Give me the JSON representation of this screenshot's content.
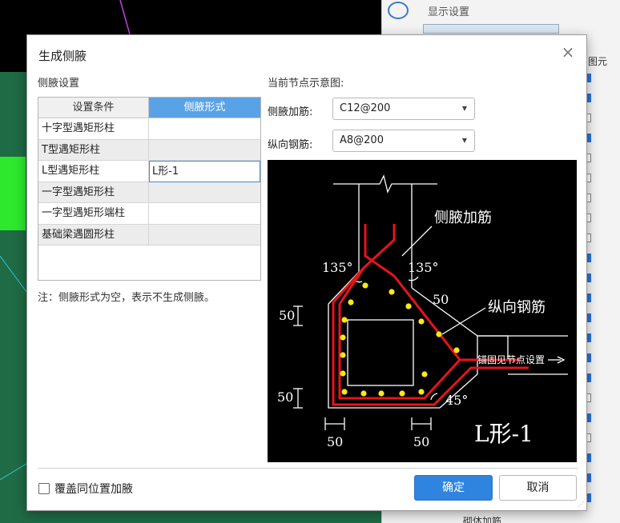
{
  "background": {
    "panel_title": "显示设置",
    "panel_column_header": "图元",
    "bottom_item": "砌体加筋",
    "check_states": [
      true,
      true,
      false,
      true,
      false,
      false,
      false,
      false,
      false,
      true,
      true,
      true,
      true,
      true,
      true,
      true,
      false,
      true,
      false,
      true,
      true,
      true
    ]
  },
  "dialog": {
    "title": "生成侧腋",
    "close_glyph": "×",
    "left_section_label": "侧腋设置",
    "right_section_label": "当前节点示意图:",
    "table": {
      "headers": [
        "设置条件",
        "侧腋形式"
      ],
      "rows": [
        [
          "十字型遇矩形柱",
          ""
        ],
        [
          "T型遇矩形柱",
          ""
        ],
        [
          "L型遇矩形柱",
          "L形-1"
        ],
        [
          "一字型遇矩形柱",
          ""
        ],
        [
          "一字型遇矩形端柱",
          ""
        ],
        [
          "基础梁遇圆形柱",
          ""
        ]
      ],
      "selected_row": 2
    },
    "note": "注：侧腋形式为空，表示不生成侧腋。",
    "fields": {
      "side_rebar_label": "侧腋加筋:",
      "side_rebar_value": "C12@200",
      "long_rebar_label": "纵向钢筋:",
      "long_rebar_value": "A8@200"
    },
    "diagram": {
      "label_side_rebar": "侧腋加筋",
      "label_long_rebar": "纵向钢筋",
      "label_anchor": "锚固见节点设置",
      "angle_left": "135°",
      "angle_right": "135°",
      "angle_bottom": "45°",
      "dim_top_right": "50",
      "dim_left_upper": "50",
      "dim_left_lower": "50",
      "dim_bottom_left": "50",
      "dim_bottom_right": "50",
      "shape_name": "L形-1",
      "colors": {
        "rebar": "#e8141a",
        "bar_dot": "#ffe61a",
        "line": "#ffffff"
      }
    },
    "footer": {
      "overwrite_label": "覆盖同位置加腋",
      "overwrite_checked": false,
      "ok_label": "确定",
      "cancel_label": "取消"
    }
  }
}
